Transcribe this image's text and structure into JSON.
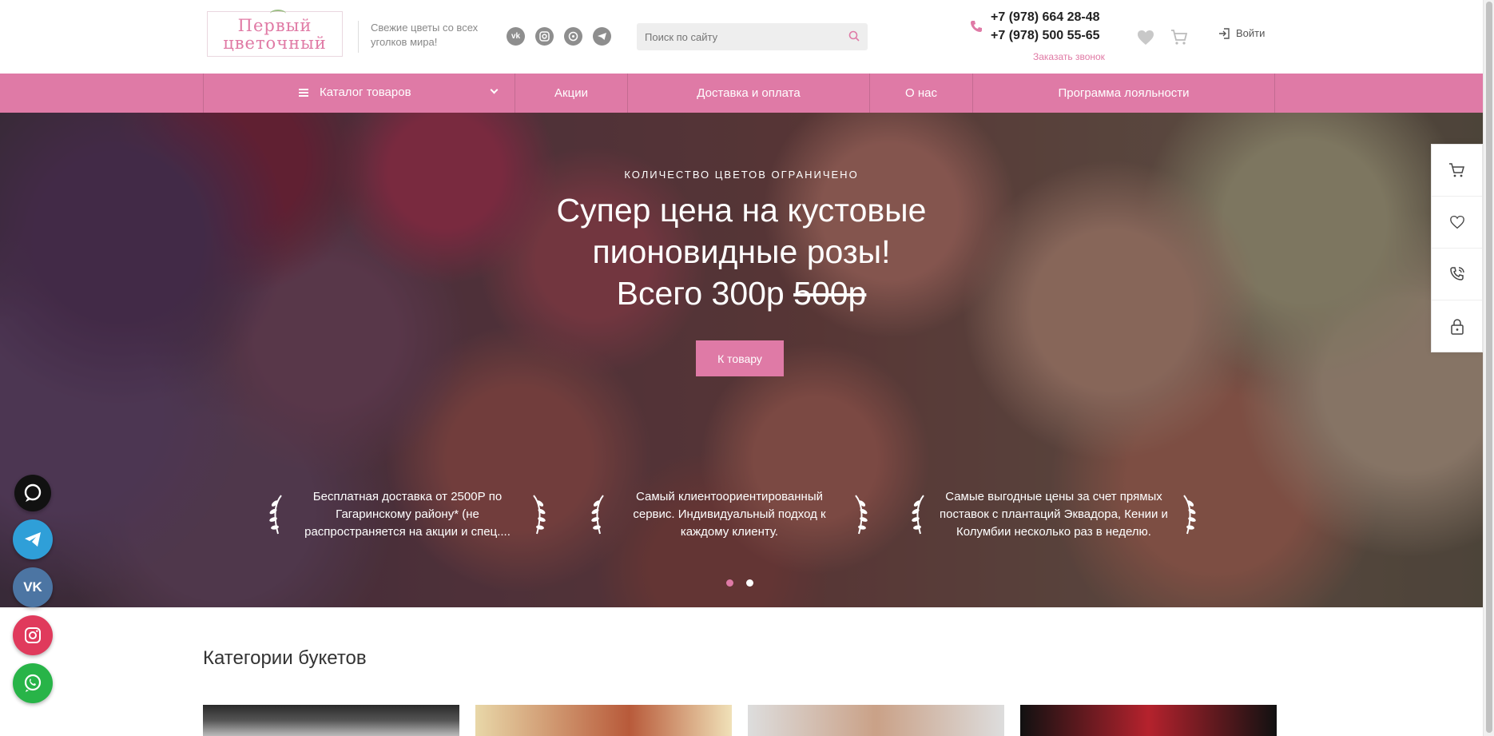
{
  "header": {
    "logo_text": "Первый цветочный",
    "tagline": "Свежие цветы со всех уголков мира!",
    "socials": [
      {
        "label": "vk",
        "icon": "vk-icon"
      },
      {
        "label": "ig",
        "icon": "instagram-icon"
      },
      {
        "label": "wa",
        "icon": "whatsapp-icon"
      },
      {
        "label": "tg",
        "icon": "telegram-icon"
      }
    ],
    "search_placeholder": "Поиск по сайту",
    "phone_1": "+7 (978) 664 28-48",
    "phone_2": "+7 (978) 500 55-65",
    "callback_label": "Заказать звонок",
    "login_label": "Войти"
  },
  "nav": {
    "catalog_label": "Каталог товаров",
    "items": [
      "Акции",
      "Доставка и оплата",
      "О нас",
      "Программа лояльности"
    ]
  },
  "hero": {
    "kicker": "КОЛИЧЕСТВО ЦВЕТОВ ОГРАНИЧЕНО",
    "title": "Супер цена на кустовые пионовидные розы!",
    "price_prefix": "Всего 300р",
    "price_old": "500р",
    "button_label": "К товару",
    "features": [
      "Бесплатная доставка от 2500Р по Гагаринскому району* (не распространяется на акции и спец....",
      "Самый клиентоориентированный сервис. Индивидуальный подход к каждому клиенту.",
      "Самые выгодные цены за счет прямых поставок с плантаций Эквадора, Кении и Колумбии несколько раз в неделю."
    ],
    "slides_total": 2,
    "active_slide": 1
  },
  "categories": {
    "title": "Категории букетов"
  },
  "colors": {
    "accent": "#df7aa6",
    "text": "#333333"
  }
}
